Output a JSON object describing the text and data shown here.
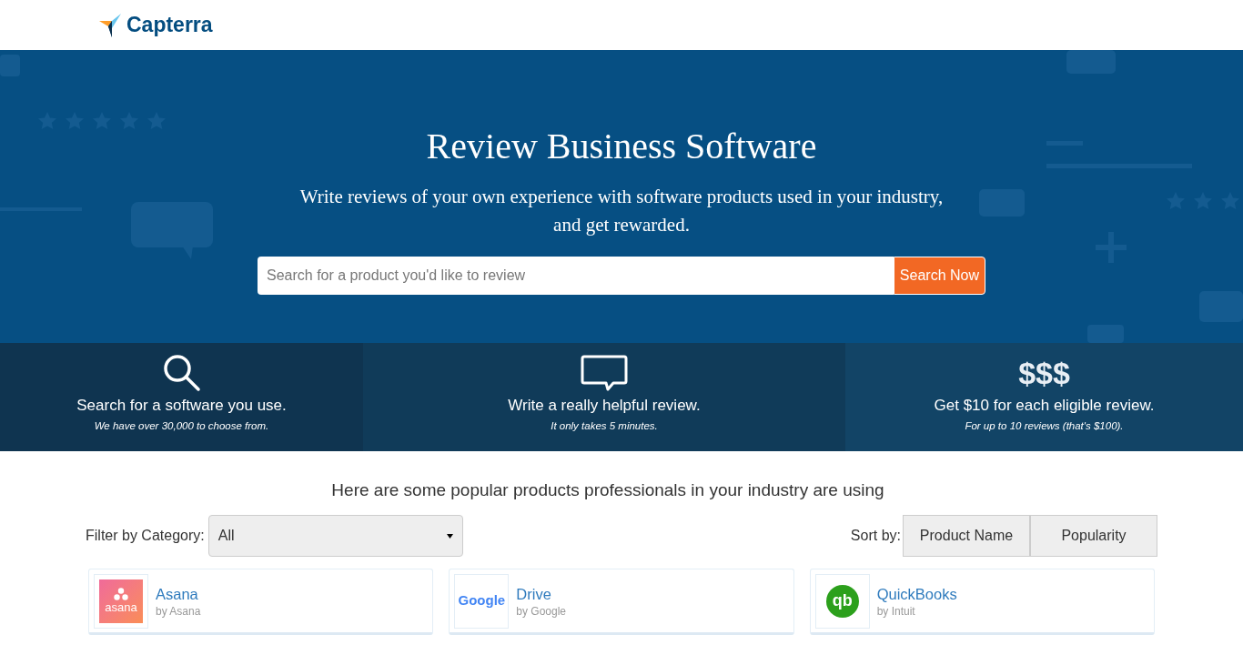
{
  "header": {
    "logo": "Capterra"
  },
  "hero": {
    "title": "Review Business Software",
    "subtitle": "Write reviews of your own experience with software products used in your industry, and get rewarded.",
    "search": {
      "placeholder": "Search for a product you'd like to review",
      "button": "Search Now"
    }
  },
  "steps": [
    {
      "kind": "search",
      "title": "Search for a software you use.",
      "note": "We have over 30,000 to choose from."
    },
    {
      "kind": "chat",
      "title": "Write a really helpful review.",
      "note": "It only takes 5 minutes."
    },
    {
      "kind": "money",
      "glyph": "$$$",
      "title": "Get $10 for each eligible review.",
      "note": "For up to 10 reviews (that's $100)."
    }
  ],
  "products_heading": "Here are some popular products professionals in your industry are using",
  "filter": {
    "label": "Filter by Category:",
    "value": "All"
  },
  "sort": {
    "label": "Sort by:",
    "options": [
      "Product Name",
      "Popularity"
    ]
  },
  "products": [
    {
      "kind": "asana",
      "logo_text": "asana",
      "name": "Asana",
      "vendor": "by Asana"
    },
    {
      "kind": "google",
      "logo_text": "Google",
      "name": "Drive",
      "vendor": "by Google"
    },
    {
      "kind": "quickbooks",
      "logo_text": "qb",
      "name": "QuickBooks",
      "vendor": "by Intuit"
    }
  ]
}
